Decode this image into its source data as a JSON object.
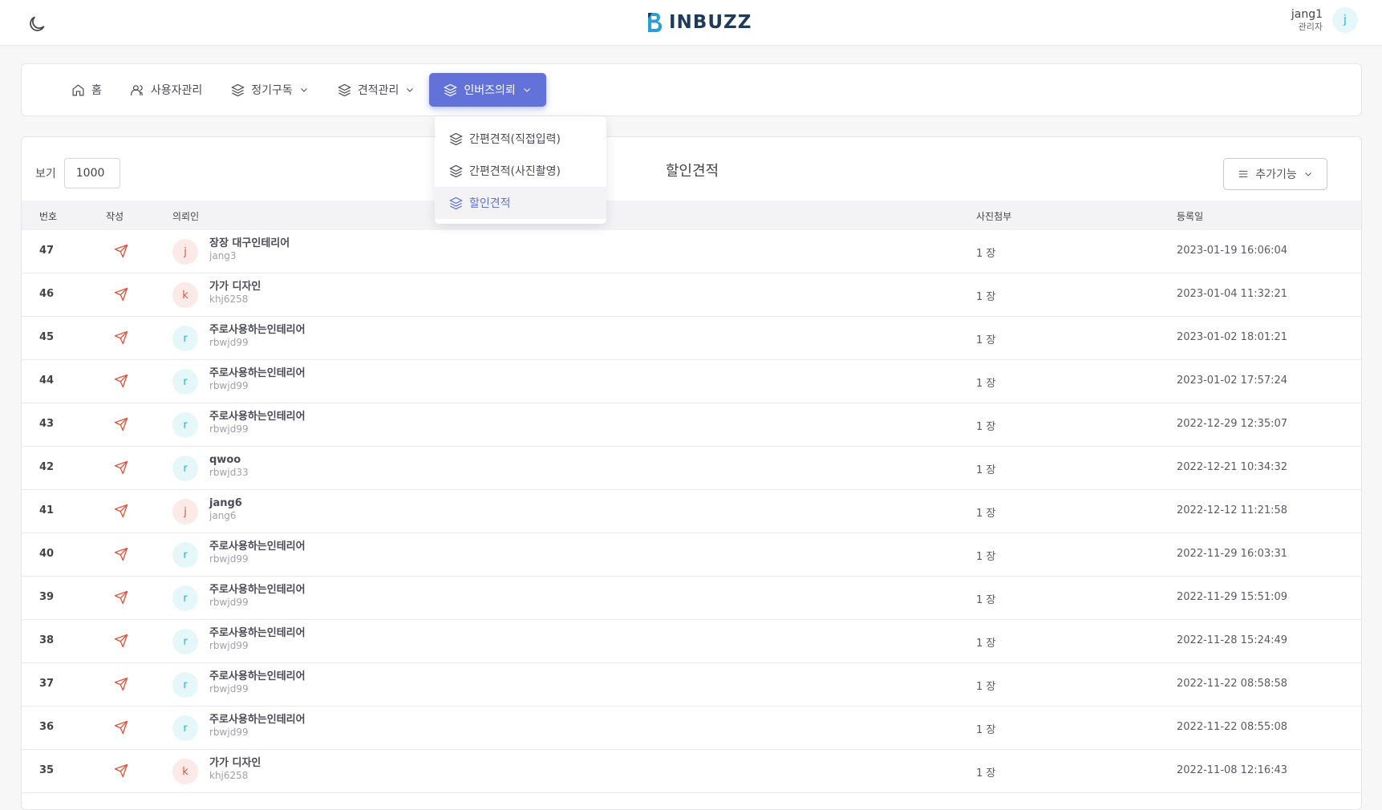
{
  "header": {
    "logo_text": "INBUZZ",
    "user_name": "jang1",
    "user_role": "관리자",
    "avatar_letter": "j"
  },
  "nav": {
    "items": [
      {
        "label": "홈",
        "icon": "home-icon",
        "dropdown": false,
        "active": false
      },
      {
        "label": "사용자관리",
        "icon": "users-icon",
        "dropdown": false,
        "active": false
      },
      {
        "label": "정기구독",
        "icon": "layers-icon",
        "dropdown": true,
        "active": false
      },
      {
        "label": "견적관리",
        "icon": "layers-icon",
        "dropdown": true,
        "active": false
      },
      {
        "label": "인버즈의뢰",
        "icon": "layers-icon",
        "dropdown": true,
        "active": true
      }
    ],
    "dropdown_items": [
      {
        "label": "간편견적(직접입력)",
        "active": false
      },
      {
        "label": "간편견적(사진촬영)",
        "active": false
      },
      {
        "label": "할인견적",
        "active": true
      }
    ]
  },
  "toolbar": {
    "show_label": "보기",
    "show_value": "1000",
    "title": "할인견적",
    "extra_label": "추가기능"
  },
  "table": {
    "columns": [
      "번호",
      "작성",
      "의뢰인",
      "사진첨부",
      "등록일"
    ],
    "rows": [
      {
        "no": "47",
        "avatar": "j",
        "name": "장장 대구인테리어",
        "id": "jang3",
        "photo": "1 장",
        "date": "2023-01-19 16:06:04"
      },
      {
        "no": "46",
        "avatar": "k",
        "name": "가가 디자인",
        "id": "khj6258",
        "photo": "1 장",
        "date": "2023-01-04 11:32:21"
      },
      {
        "no": "45",
        "avatar": "r",
        "name": "주로사용하는인테리어",
        "id": "rbwjd99",
        "photo": "1 장",
        "date": "2023-01-02 18:01:21"
      },
      {
        "no": "44",
        "avatar": "r",
        "name": "주로사용하는인테리어",
        "id": "rbwjd99",
        "photo": "1 장",
        "date": "2023-01-02 17:57:24"
      },
      {
        "no": "43",
        "avatar": "r",
        "name": "주로사용하는인테리어",
        "id": "rbwjd99",
        "photo": "1 장",
        "date": "2022-12-29 12:35:07"
      },
      {
        "no": "42",
        "avatar": "r",
        "name": "qwoo",
        "id": "rbwjd33",
        "photo": "1 장",
        "date": "2022-12-21 10:34:32"
      },
      {
        "no": "41",
        "avatar": "j",
        "name": "jang6",
        "id": "jang6",
        "photo": "1 장",
        "date": "2022-12-12 11:21:58"
      },
      {
        "no": "40",
        "avatar": "r",
        "name": "주로사용하는인테리어",
        "id": "rbwjd99",
        "photo": "1 장",
        "date": "2022-11-29 16:03:31"
      },
      {
        "no": "39",
        "avatar": "r",
        "name": "주로사용하는인테리어",
        "id": "rbwjd99",
        "photo": "1 장",
        "date": "2022-11-29 15:51:09"
      },
      {
        "no": "38",
        "avatar": "r",
        "name": "주로사용하는인테리어",
        "id": "rbwjd99",
        "photo": "1 장",
        "date": "2022-11-28 15:24:49"
      },
      {
        "no": "37",
        "avatar": "r",
        "name": "주로사용하는인테리어",
        "id": "rbwjd99",
        "photo": "1 장",
        "date": "2022-11-22 08:58:58"
      },
      {
        "no": "36",
        "avatar": "r",
        "name": "주로사용하는인테리어",
        "id": "rbwjd99",
        "photo": "1 장",
        "date": "2022-11-22 08:55:08"
      },
      {
        "no": "35",
        "avatar": "k",
        "name": "가가 디자인",
        "id": "khj6258",
        "photo": "1 장",
        "date": "2022-11-08 12:16:43"
      }
    ]
  },
  "colors": {
    "accent": "#6272d8",
    "send_icon": "#e0533c",
    "avatar_cyan": "#20b8d6"
  }
}
